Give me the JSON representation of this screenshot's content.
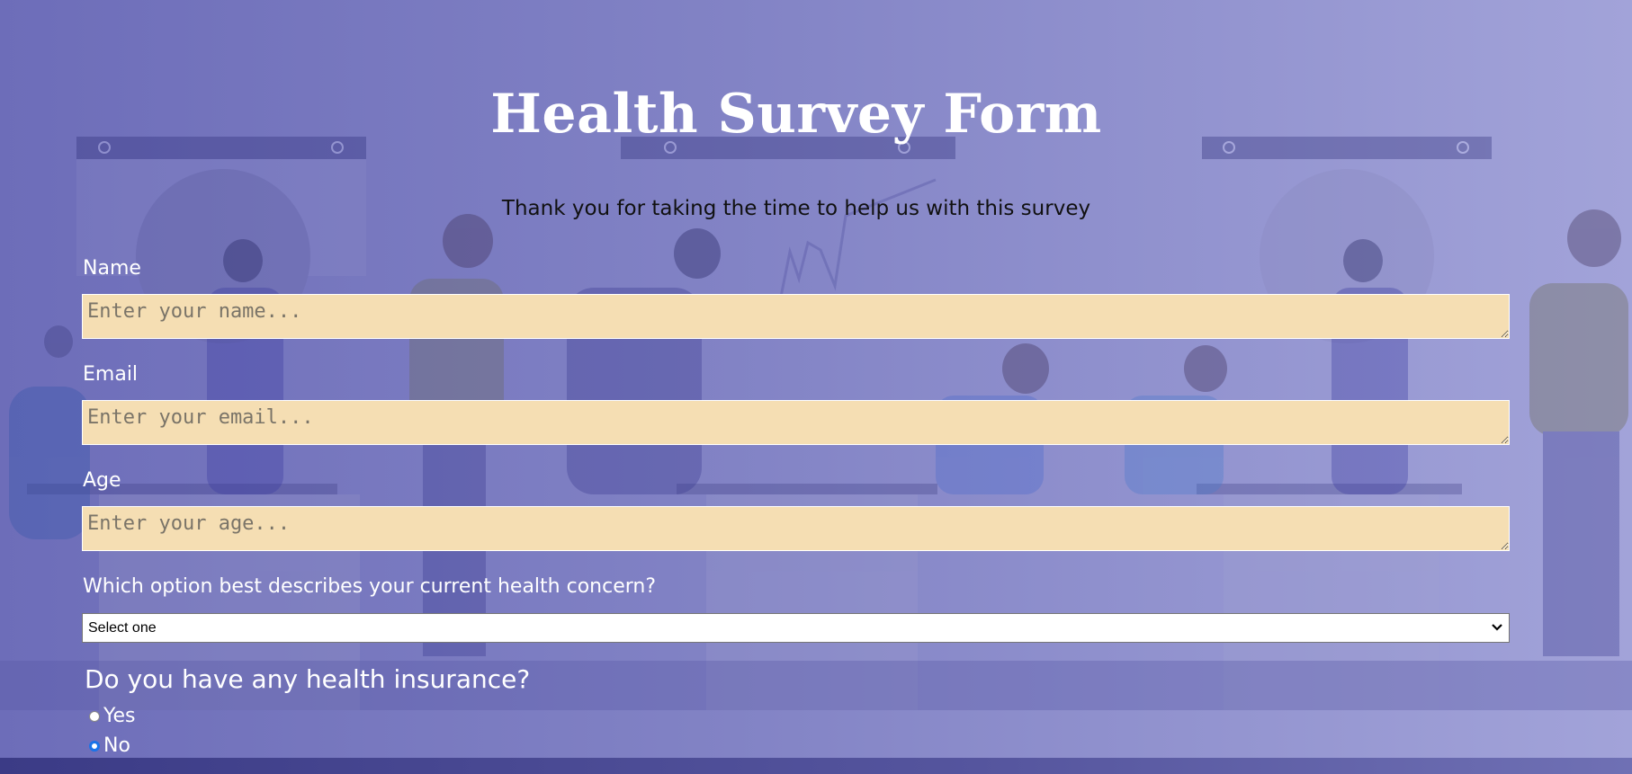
{
  "page": {
    "title": "Health Survey Form",
    "description": "Thank you for taking the time to help us with this survey"
  },
  "form": {
    "name": {
      "label": "Name",
      "placeholder": "Enter your name..."
    },
    "email": {
      "label": "Email",
      "placeholder": "Enter your email..."
    },
    "age": {
      "label": "Age",
      "placeholder": "Enter your age..."
    },
    "concern": {
      "label": "Which option best describes your current health concern?",
      "selected": "Select one"
    },
    "insurance": {
      "question": "Do you have any health insurance?",
      "options": [
        {
          "label": "Yes",
          "checked": false
        },
        {
          "label": "No",
          "checked": true
        }
      ]
    }
  },
  "colors": {
    "input_background": "#f5deb3",
    "background_start": "#6d6db9",
    "background_end": "#a2a3d9",
    "radio_accent": "#1a73e8"
  },
  "icons": {
    "select_arrow": "chevron-down-icon"
  }
}
